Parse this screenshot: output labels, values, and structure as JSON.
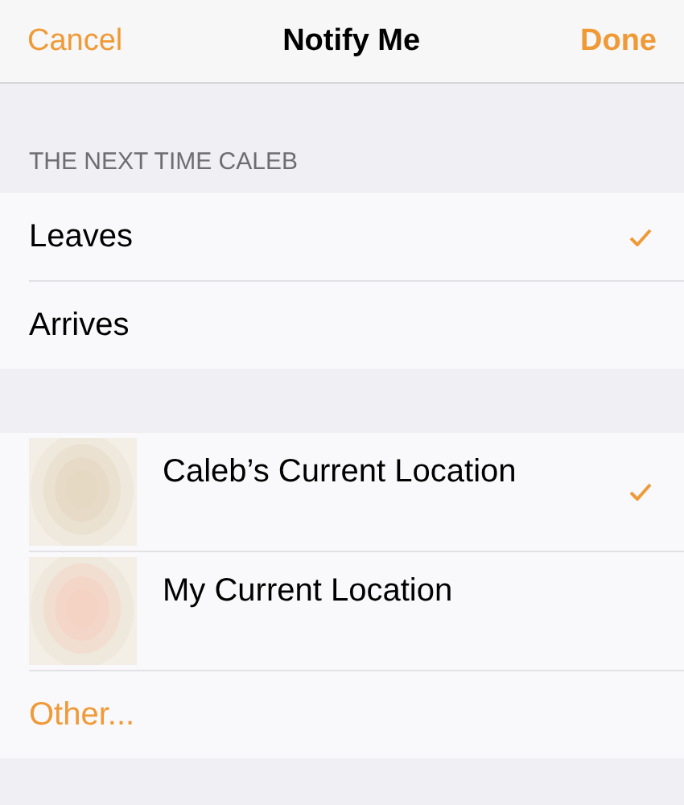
{
  "nav": {
    "cancel": "Cancel",
    "title": "Notify Me",
    "done": "Done"
  },
  "section": {
    "header": "THE NEXT TIME CALEB",
    "options": [
      {
        "label": "Leaves",
        "selected": true
      },
      {
        "label": "Arrives",
        "selected": false
      }
    ]
  },
  "locations": [
    {
      "label": "Caleb’s Current Location",
      "selected": true,
      "color": "#e6d9c3"
    },
    {
      "label": "My Current Location",
      "selected": false,
      "color": "#f5d3c4"
    }
  ],
  "other": "Other..."
}
